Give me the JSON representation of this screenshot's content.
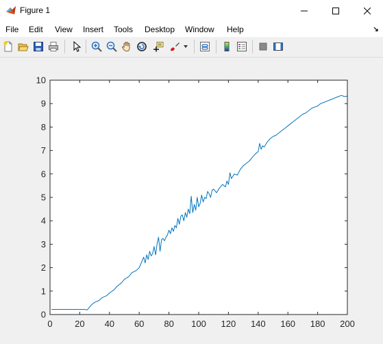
{
  "window": {
    "title": "Figure 1",
    "minimize_icon": "minimize-icon",
    "maximize_icon": "maximize-icon",
    "close_icon": "close-icon"
  },
  "menu": {
    "items": [
      "File",
      "Edit",
      "View",
      "Insert",
      "Tools",
      "Desktop",
      "Window",
      "Help"
    ],
    "overflow_icon": "menu-arrow-icon"
  },
  "toolbar": {
    "buttons": [
      "new-figure-icon",
      "open-file-icon",
      "save-icon",
      "print-icon",
      "select-arrow-icon",
      "zoom-in-icon",
      "zoom-out-icon",
      "pan-hand-icon",
      "rotate-3d-icon",
      "data-cursor-icon",
      "brush-icon",
      "link-plot-icon",
      "colorbar-icon",
      "legend-icon",
      "hide-plot-tools-icon",
      "show-plot-tools-icon"
    ]
  },
  "colors": {
    "line": "#0072BD",
    "axes_bg": "#ffffff",
    "figure_bg": "#f0f0f0",
    "axis_color": "#262626"
  },
  "chart_data": {
    "type": "line",
    "title": "",
    "xlabel": "",
    "ylabel": "",
    "xlim": [
      0,
      200
    ],
    "ylim": [
      0,
      10
    ],
    "xticks": [
      0,
      20,
      40,
      60,
      80,
      100,
      120,
      140,
      160,
      180,
      200
    ],
    "yticks": [
      0,
      1,
      2,
      3,
      4,
      5,
      6,
      7,
      8,
      9,
      10
    ],
    "grid": false,
    "series": [
      {
        "x": [
          1,
          10,
          20,
          23,
          25,
          28,
          30,
          33,
          35,
          38,
          40,
          43,
          45,
          48,
          50,
          53,
          55,
          58,
          60,
          61,
          62,
          63,
          64,
          65,
          66,
          67,
          68,
          69,
          70,
          71,
          72,
          73,
          74,
          75,
          76,
          77,
          78,
          79,
          80,
          81,
          82,
          83,
          84,
          85,
          86,
          87,
          88,
          89,
          90,
          91,
          92,
          93,
          94,
          95,
          96,
          97,
          98,
          99,
          100,
          101,
          102,
          103,
          104,
          105,
          106,
          107,
          108,
          109,
          110,
          112,
          114,
          116,
          118,
          119,
          120,
          121,
          122,
          124,
          126,
          128,
          130,
          132,
          134,
          136,
          138,
          140,
          141,
          142,
          143,
          144,
          146,
          148,
          150,
          152,
          154,
          156,
          158,
          160,
          162,
          164,
          166,
          168,
          170,
          172,
          174,
          176,
          178,
          180,
          182,
          184,
          186,
          188,
          190,
          192,
          194,
          196,
          198,
          200
        ],
        "y": [
          0.22,
          0.22,
          0.22,
          0.22,
          0.2,
          0.42,
          0.52,
          0.6,
          0.72,
          0.8,
          0.92,
          1.05,
          1.2,
          1.35,
          1.5,
          1.62,
          1.78,
          1.88,
          2.0,
          2.15,
          2.3,
          2.45,
          2.2,
          2.55,
          2.35,
          2.7,
          2.5,
          2.6,
          2.9,
          2.55,
          3.0,
          3.3,
          2.7,
          3.2,
          3.25,
          3.15,
          3.3,
          3.4,
          3.6,
          3.45,
          3.7,
          3.55,
          3.8,
          3.7,
          4.1,
          3.85,
          4.2,
          4.25,
          4.0,
          4.35,
          4.15,
          4.5,
          4.3,
          5.05,
          4.35,
          4.7,
          4.45,
          5.0,
          4.6,
          4.75,
          5.1,
          4.8,
          5.0,
          4.95,
          5.25,
          5.15,
          5.0,
          5.3,
          5.35,
          5.2,
          5.4,
          5.55,
          5.45,
          5.7,
          5.55,
          6.05,
          5.8,
          6.0,
          5.95,
          6.2,
          6.35,
          6.45,
          6.55,
          6.7,
          6.85,
          6.95,
          7.3,
          7.05,
          7.2,
          7.15,
          7.35,
          7.5,
          7.6,
          7.65,
          7.75,
          7.85,
          7.95,
          8.05,
          8.15,
          8.25,
          8.35,
          8.45,
          8.55,
          8.6,
          8.7,
          8.8,
          8.85,
          8.9,
          9.0,
          9.05,
          9.1,
          9.15,
          9.2,
          9.25,
          9.3,
          9.35,
          9.3,
          9.32
        ]
      }
    ]
  }
}
